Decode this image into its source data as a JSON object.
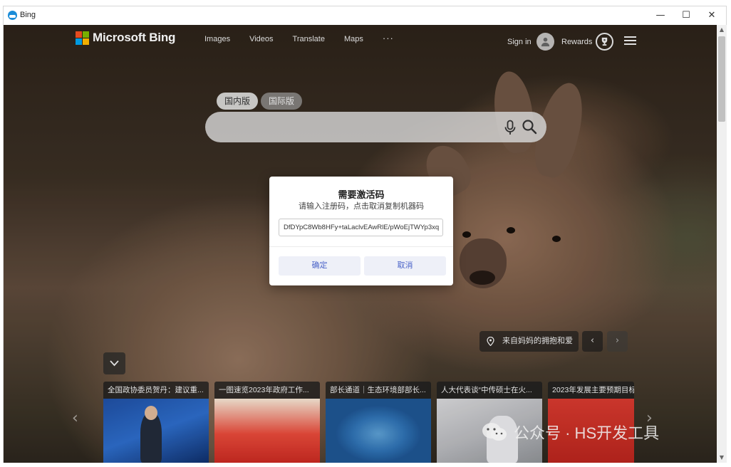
{
  "window": {
    "title": "Bing",
    "controls": {
      "minimize": "—",
      "maximize": "☐",
      "close": "✕"
    }
  },
  "header": {
    "brand": "Microsoft Bing",
    "nav": [
      {
        "label": "Images"
      },
      {
        "label": "Videos"
      },
      {
        "label": "Translate"
      },
      {
        "label": "Maps"
      }
    ],
    "more": "···",
    "signin_label": "Sign in",
    "rewards_label": "Rewards"
  },
  "search": {
    "tabs": [
      {
        "label": "国内版",
        "active": true
      },
      {
        "label": "国际版",
        "active": false
      }
    ],
    "value": "",
    "placeholder": ""
  },
  "dialog": {
    "title": "需要激活码",
    "subtitle": "请输入注册码，点击取消复制机器码",
    "code_value": "DfDYpC8Wb8HFy+taLaclvEAwRlE/pWoEjTWYp3xq",
    "ok_label": "确定",
    "cancel_label": "取消"
  },
  "background_caption": {
    "text": "来自妈妈的拥抱和爱",
    "prev": "‹",
    "next": "›"
  },
  "news": [
    {
      "title": "全国政协委员贺丹：建议重..."
    },
    {
      "title": "一图速览2023年政府工作..."
    },
    {
      "title": "部长通道｜生态环境部部长..."
    },
    {
      "title": "人大代表谈“中传硕士在火..."
    },
    {
      "title": "2023年发展主要预期目标"
    }
  ],
  "carousel": {
    "left": "‹",
    "right": "›"
  },
  "watermark": {
    "text": "公众号 · HS开发工具"
  },
  "scrollbar": {
    "up": "▲",
    "down": "▼"
  },
  "colors": {
    "dialog_button_text": "#4a63c8",
    "dialog_button_bg": "#eef0f8",
    "ms_red": "#f25022",
    "ms_green": "#7fba00",
    "ms_blue": "#00a4ef",
    "ms_yellow": "#ffb900"
  },
  "icons": {
    "app": "bing-app-icon",
    "avatar": "person-icon",
    "rewards": "trophy-icon",
    "menu": "hamburger-menu-icon",
    "mic": "microphone-icon",
    "search": "search-icon",
    "location": "location-pin-icon",
    "collapse": "chevron-down-icon",
    "watermark": "wechat-icon"
  }
}
